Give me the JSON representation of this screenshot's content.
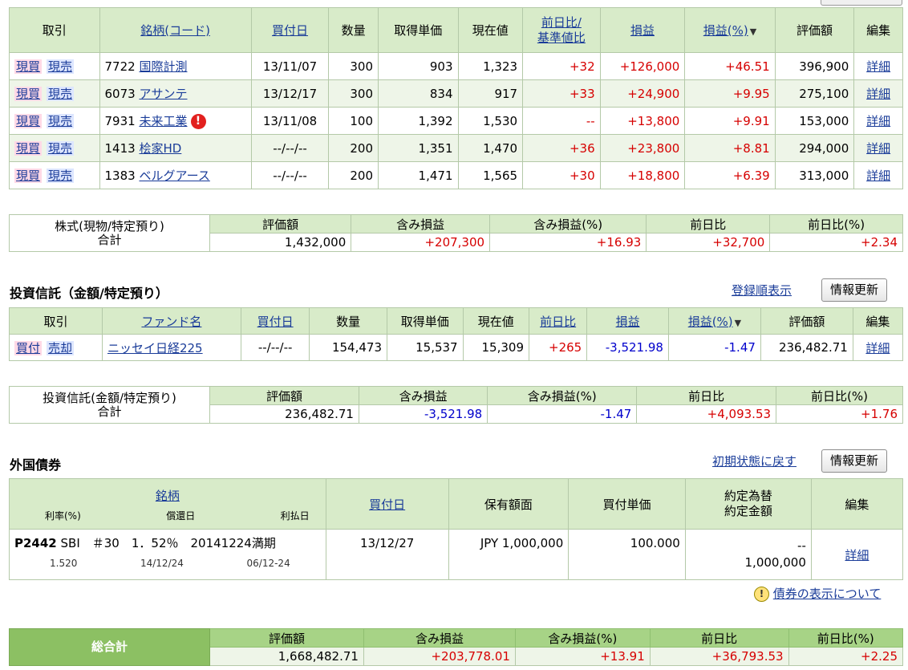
{
  "stocks": {
    "headers": {
      "trade": "取引",
      "name": "銘柄(コード)",
      "buy_date": "買付日",
      "qty": "数量",
      "cost": "取得単価",
      "price": "現在値",
      "change_l1": "前日比/",
      "change_l2": "基準値比",
      "pl": "損益",
      "pl_pct": "損益(%)",
      "value": "評価額",
      "edit": "編集"
    },
    "rows": [
      {
        "buy": "現買",
        "sell": "現売",
        "code": "7722",
        "name": "国際計測",
        "date": "13/11/07",
        "qty": "300",
        "cost": "903",
        "price": "1,323",
        "change": "+32",
        "pl": "+126,000",
        "pct": "+46.51",
        "value": "396,900",
        "detail": "詳細",
        "warn": false
      },
      {
        "buy": "現買",
        "sell": "現売",
        "code": "6073",
        "name": "アサンテ",
        "date": "13/12/17",
        "qty": "300",
        "cost": "834",
        "price": "917",
        "change": "+33",
        "pl": "+24,900",
        "pct": "+9.95",
        "value": "275,100",
        "detail": "詳細",
        "warn": false
      },
      {
        "buy": "現買",
        "sell": "現売",
        "code": "7931",
        "name": "未来工業",
        "date": "13/11/08",
        "qty": "100",
        "cost": "1,392",
        "price": "1,530",
        "change": "--",
        "pl": "+13,800",
        "pct": "+9.91",
        "value": "153,000",
        "detail": "詳細",
        "warn": true
      },
      {
        "buy": "現買",
        "sell": "現売",
        "code": "1413",
        "name": "桧家HD",
        "date": "--/--/--",
        "qty": "200",
        "cost": "1,351",
        "price": "1,470",
        "change": "+36",
        "pl": "+23,800",
        "pct": "+8.81",
        "value": "294,000",
        "detail": "詳細",
        "warn": false
      },
      {
        "buy": "現買",
        "sell": "現売",
        "code": "1383",
        "name": "ベルグアース",
        "date": "--/--/--",
        "qty": "200",
        "cost": "1,471",
        "price": "1,565",
        "change": "+30",
        "pl": "+18,800",
        "pct": "+6.39",
        "value": "313,000",
        "detail": "詳細",
        "warn": false
      }
    ],
    "warn_symbol": "!"
  },
  "stock_summary": {
    "label1": "株式(現物/特定預り)",
    "label2": "合計",
    "headers": [
      "評価額",
      "含み損益",
      "含み損益(%)",
      "前日比",
      "前日比(%)"
    ],
    "values": [
      "1,432,000",
      "+207,300",
      "+16.93",
      "+32,700",
      "+2.34"
    ]
  },
  "funds": {
    "title": "投資信託（金額/特定預り）",
    "link": "登録順表示",
    "refresh": "情報更新",
    "headers": {
      "trade": "取引",
      "name": "ファンド名",
      "buy_date": "買付日",
      "qty": "数量",
      "cost": "取得単価",
      "price": "現在値",
      "change": "前日比",
      "pl": "損益",
      "pl_pct": "損益(%)",
      "value": "評価額",
      "edit": "編集"
    },
    "row": {
      "buy": "買付",
      "sell": "売却",
      "name": "ニッセイ日経225",
      "date": "--/--/--",
      "qty": "154,473",
      "cost": "15,537",
      "price": "15,309",
      "change": "+265",
      "pl": "-3,521.98",
      "pct": "-1.47",
      "value": "236,482.71",
      "detail": "詳細"
    }
  },
  "fund_summary": {
    "label1": "投資信託(金額/特定預り)",
    "label2": "合計",
    "headers": [
      "評価額",
      "含み損益",
      "含み損益(%)",
      "前日比",
      "前日比(%)"
    ],
    "values": [
      "236,482.71",
      "-3,521.98",
      "-1.47",
      "+4,093.53",
      "+1.76"
    ]
  },
  "bonds": {
    "title": "外国債券",
    "link": "初期状態に戻す",
    "refresh": "情報更新",
    "headers": {
      "name": "銘柄",
      "rate": "利率(%)",
      "maturity": "償還日",
      "payday": "利払日",
      "buy_date": "買付日",
      "face": "保有額面",
      "unit_price": "買付単価",
      "fx1": "約定為替",
      "fx2": "約定金額",
      "edit": "編集"
    },
    "row": {
      "code": "P2442",
      "name": "SBI　＃30　1．52％　20141224満期",
      "rate": "1.520",
      "maturity": "14/12/24",
      "payday": "06/12-24",
      "date": "13/12/27",
      "face": "JPY 1,000,000",
      "unit_price": "100.000",
      "fx": "--",
      "amount": "1,000,000",
      "detail": "詳細"
    },
    "note_icon": "!",
    "note": "債券の表示について"
  },
  "total": {
    "label": "総合計",
    "headers": [
      "評価額",
      "含み損益",
      "含み損益(%)",
      "前日比",
      "前日比(%)"
    ],
    "values": [
      "1,668,482.71",
      "+203,778.01",
      "+13.91",
      "+36,793.53",
      "+2.25"
    ]
  }
}
